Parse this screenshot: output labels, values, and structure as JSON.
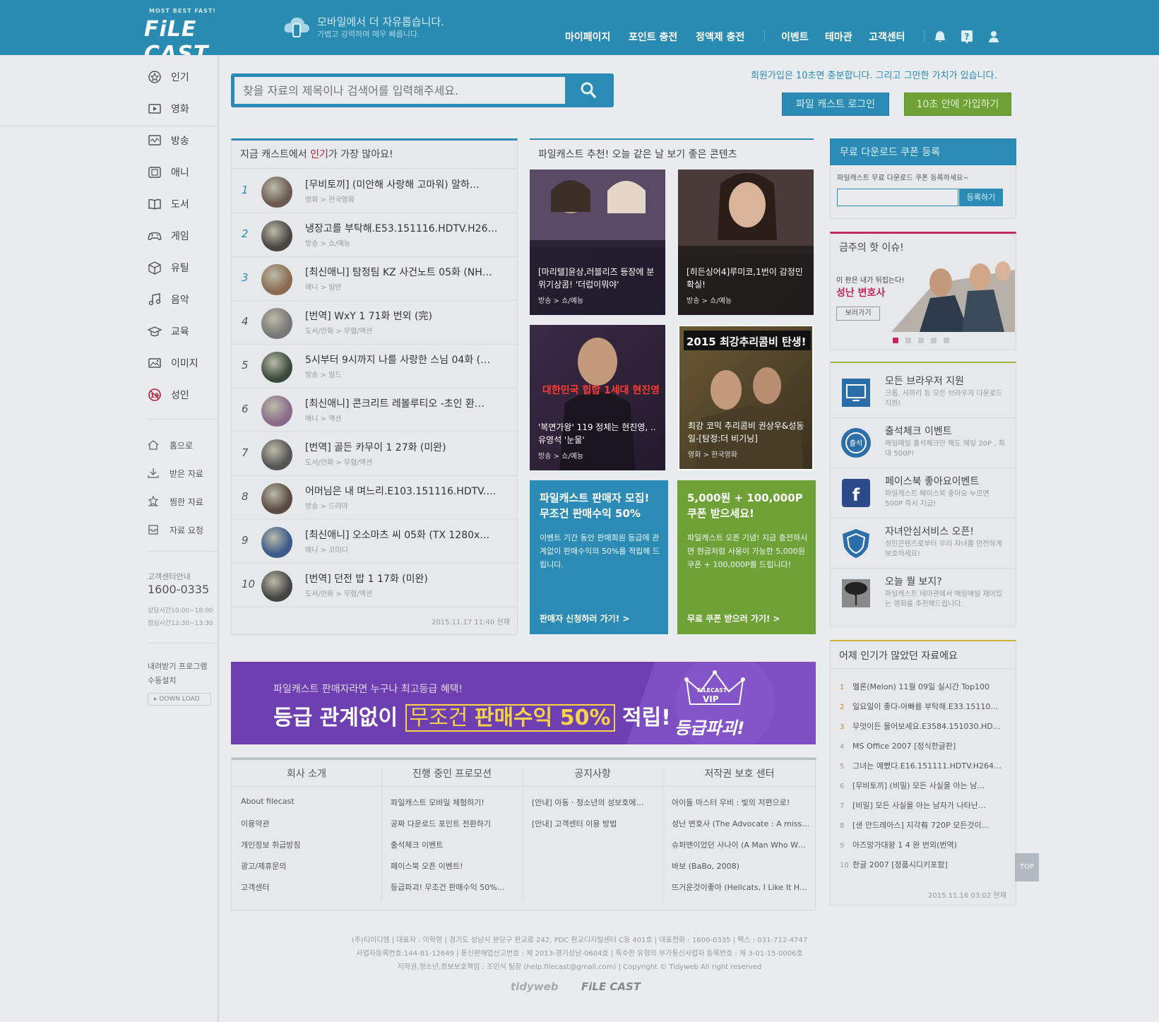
{
  "header": {
    "logo_small": "MOST BEST FAST!",
    "logo_text": "FiLE CAST",
    "slogan_main": "모바일에서 더 자유롭습니다.",
    "slogan_sub": "가볍고 강력하며 매우 빠릅니다.",
    "nav": [
      "마이페이지",
      "포인트 충전",
      "정액제 충전",
      "이벤트",
      "테마관",
      "고객센터"
    ],
    "icons": [
      "bell-icon",
      "help-icon",
      "user-icon"
    ]
  },
  "sidebar": {
    "categories": [
      "인기",
      "영화",
      "방송",
      "애니",
      "도서",
      "게임",
      "유틸",
      "음악",
      "교육",
      "이미지",
      "성인"
    ],
    "links": [
      "홈으로",
      "받은 자료",
      "찜한 자료",
      "자료 요청"
    ],
    "cs_label": "고객센터안내",
    "cs_phone": "1600-0335",
    "cs_hours1": "상담시간10:00~18:00",
    "cs_hours2": "점심시간12:30~13:30",
    "download_label1": "내려받기 프로그램",
    "download_label2": "수동설치",
    "download_button": "DOWN LOAD"
  },
  "search": {
    "placeholder": "찾을 자료의 제목이나 검색어를 입력해주세요."
  },
  "join": {
    "message": "회원가입은 10초면 충분합니다. 그리고 그만한 가치가 있습니다.",
    "login_button": "파일 캐스트 로그인",
    "join_button": "10초 안에 가입하기"
  },
  "popular": {
    "title_prefix": "지금 캐스트에서 ",
    "title_hl": "인기",
    "title_suffix": "가 가장 많아요!",
    "items": [
      {
        "rank": "1",
        "title": "[무비토끼] (미안해 사랑해 고마워) 말하…",
        "cat": "영화 > 한국영화"
      },
      {
        "rank": "2",
        "title": "냉장고를 부탁해.E53.151116.HDTV.H26…",
        "cat": "방송 > 쇼/예능"
      },
      {
        "rank": "3",
        "title": "[최신애니] 탐정팀 KZ 사건노트 05화 (NH…",
        "cat": "애니 > 일반"
      },
      {
        "rank": "4",
        "title": "[번역] WxY 1 71화 번외 (完)",
        "cat": "도서/만화 > 무협/액션"
      },
      {
        "rank": "5",
        "title": "5시부터 9시까지 나를 사랑한 스님 04화 (…",
        "cat": "방송 > 일드"
      },
      {
        "rank": "6",
        "title": "[최신애니] 콘크리트 레볼루티오 -초인 환…",
        "cat": "애니 > 액션"
      },
      {
        "rank": "7",
        "title": "[번역] 골든 카무이 1 27화 (미완)",
        "cat": "도서/만화 > 무협/액션"
      },
      {
        "rank": "8",
        "title": "어머님은 내 며느리.E103.151116.HDTV.…",
        "cat": "방송 > 드라마"
      },
      {
        "rank": "9",
        "title": "[최신애니] 오소마츠 씨 05화 (TX 1280x…",
        "cat": "애니 > 코미디"
      },
      {
        "rank": "10",
        "title": "[번역] 던전 밥 1 17화 (미완)",
        "cat": "도서/만화 > 무협/액션"
      }
    ],
    "timestamp": "2015.11.17 11:40 현재"
  },
  "recommend": {
    "title": "파일캐스트 추천! 오늘 같은 날 보기 좋은 콘텐츠",
    "items": [
      {
        "caption": "[마리텔]윤상,러블리즈 등장에 분위기상콤! '더럽이뭐야'",
        "cat": "방송 > 쇼/예능"
      },
      {
        "caption": "[히든싱어4]루미코,1번이 감정민 확실!",
        "cat": "방송 > 쇼/예능"
      },
      {
        "caption": "'복면가왕' 119 정체는 현진영, ..유영석 '눈물'",
        "cat": "방송 > 쇼/예능",
        "overlay": "대한민국 힙합 1세대 현진영"
      },
      {
        "caption": "최강 코믹 추리콤비 권상우&성동일-[탐정:더 비기닝]",
        "cat": "영화 > 한국영화",
        "overlay": "2015 최강추리콤비 탄생!"
      }
    ]
  },
  "promos": [
    {
      "title1": "파일캐스트 판매자 모집!",
      "title2": "무조건 판매수익 50%",
      "desc": "이벤트 기간 동안 판매회원 등급에 관계없이 판매수익의 50%를 적립해 드립니다.",
      "link": "판매자 신청하러 가기! >",
      "color": "#2b8bb5"
    },
    {
      "title1": "5,000원 + 100,000P",
      "title2": "쿠폰 받으세요!",
      "desc": "파일캐스트 오픈 기념! 지금 충전하시면 현금처럼 사용이 가능한 5,000원 쿠폰 + 100,000P를 드립니다!",
      "link": "무료 쿠폰 받으러 가기! >",
      "color": "#6fa236"
    }
  ],
  "banner": {
    "sub": "파일캐스트 판매자라면 누구나 최고등급 혜택!",
    "main1": "등급 관계없이",
    "main2": "무조건",
    "main3": "판매수익 50%",
    "main4": "적립!",
    "badge1": "FILECAST",
    "badge2": "VIP",
    "badge3": "등급파괴!"
  },
  "footer_cols": [
    {
      "title": "회사 소개",
      "links": [
        "About filecast",
        "이용약관",
        "개인정보 취급방침",
        "광고/제휴문의",
        "고객센터"
      ]
    },
    {
      "title": "진행 중인 프로모션",
      "links": [
        "파일캐스트 모바일 체험하기!",
        "공짜 다운로드 포인트 전환하기",
        "출석체크 이벤트",
        "페이스북 오픈 이벤트!",
        "등급파괴! 무조건 판매수익 50%…"
      ]
    },
    {
      "title": "공지사항",
      "links": [
        "[안내] 아동 · 청소년의 성보호에…",
        "[안내] 고객센터 이용 방법"
      ]
    },
    {
      "title": "저작권 보호 센터",
      "links": [
        "아이돌 마스터 무비 : 빛의 저편으로!",
        "성난 변호사 (The Advocate : A missi…",
        "슈퍼맨이었던 사나이 (A Man Who W…",
        "바보 (BaBo, 2008)",
        "뜨거운것이좋아 (Hellcats, I Like It Hot…"
      ]
    }
  ],
  "coupon": {
    "title": "무료 다운로드 쿠폰 등록",
    "desc": "파일캐스트 무료 다운로드 쿠폰 등록하세요~",
    "button": "등록하기"
  },
  "issue": {
    "title": "금주의 핫 이슈!",
    "sub": "이 판은 내가 뒤집는다!",
    "name": "성난 변호사",
    "button": "보러가기"
  },
  "services": [
    {
      "title": "모든 브라우저 지원",
      "desc": "크롬, 사파리 등 모든 브라우저 다운로드 지원!"
    },
    {
      "title": "출석체크 이벤트",
      "desc": "매일매일 출석체크만 해도 매일 20P , 최대 500P!"
    },
    {
      "title": "페이스북 좋아요이벤트",
      "desc": "파일캐스트 페이스북 좋아요 누르면 500P 즉시 지급!"
    },
    {
      "title": "자녀안심서비스 오픈!",
      "desc": "성인콘텐츠로부터 우리 자녀를 안전하게 보호하세요!"
    },
    {
      "title": "오늘 뭘 보지?",
      "desc": "파일캐스트 테마관에서 매일매일 재미있는 영화를 추천해드립니다."
    }
  ],
  "yesterday": {
    "title": "어제 인기가 많았던 자료에요",
    "items": [
      "멜론(Melon) 11월 09일 실시간 Top100",
      "일요일이 좋다-아빠를 부탁해.E33.15110…",
      "무엇이든 물어보세요.E3584.151030.HDT…",
      "MS Office 2007 [정식한글판]",
      "그녀는 예뻤다.E16.151111.HDTV.H264.10…",
      "[무비토끼] (비밀) 모든 사실을 아는 남…",
      "[비밀] 모든 사실을 아는 남자가 나타난…",
      "[샌 안드레아스] 지각有 720P 모든것이…",
      "아즈망가대왕 1 4 완 번외(번역)",
      "한글 2007 [정품시디키포함]"
    ],
    "timestamp": "2015.11.16 03:02 현재"
  },
  "top_button": "TOP",
  "copyright": {
    "line1": "(주)티이디엠  |  대표자 : 이학영  |  경기도 성남시 분당구 판교로 242, PDC 판교디지털센터 C동 401호  |  대표전화 : 1600-0335  |  팩스 : 031-712-4747",
    "line2": "사업자등록번호:144-81-12649  |  통신판매업신고번호 : 제 2013-경기성남-0604호  |  특수한 유형의 부가통신사업자 등록번호 : 제 3-01-15-0006호",
    "line3": "저작권,청소년,정보보호책임 : 조민식 팀장 (help.filecast@gmail.com)  |  Copyright © Tidyweb All right reserved",
    "logo1": "tidyweb",
    "logo2": "FiLE CAST"
  }
}
